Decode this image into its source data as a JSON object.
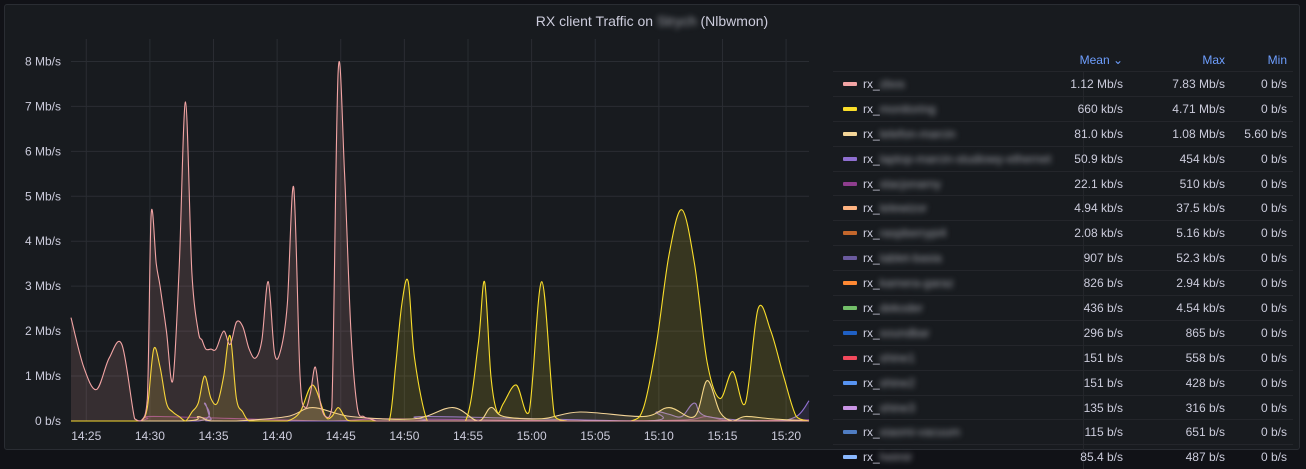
{
  "panel": {
    "title_prefix": "RX client Traffic on",
    "title_host": "Strych",
    "title_suffix": "(Nlbwmon)"
  },
  "legend": {
    "headers": {
      "mean": "Mean ⌄",
      "max": "Max",
      "min": "Min"
    },
    "rows": [
      {
        "prefix": "rx_",
        "name": "zbos",
        "color": "#f2a4a4",
        "mean": "1.12 Mb/s",
        "max": "7.83 Mb/s",
        "min": "0 b/s"
      },
      {
        "prefix": "rx_",
        "name": "monitoring",
        "color": "#fade2a",
        "mean": "660 kb/s",
        "max": "4.71 Mb/s",
        "min": "0 b/s"
      },
      {
        "prefix": "rx_",
        "name": "telefon-marcin",
        "color": "#f4d598",
        "mean": "81.0 kb/s",
        "max": "1.08 Mb/s",
        "min": "5.60 b/s"
      },
      {
        "prefix": "rx_",
        "name": "laptop-marcin-studiowy-ethernet",
        "color": "#8f6fd0",
        "mean": "50.9 kb/s",
        "max": "454 kb/s",
        "min": "0 b/s"
      },
      {
        "prefix": "rx_",
        "name": "stacjonarny",
        "color": "#8e3d8e",
        "mean": "22.1 kb/s",
        "max": "510 kb/s",
        "min": "0 b/s"
      },
      {
        "prefix": "rx_",
        "name": "telewizor",
        "color": "#ffb381",
        "mean": "4.94 kb/s",
        "max": "37.5 kb/s",
        "min": "0 b/s"
      },
      {
        "prefix": "rx_",
        "name": "raspberrypi4",
        "color": "#c4672c",
        "mean": "2.08 kb/s",
        "max": "5.16 kb/s",
        "min": "0 b/s"
      },
      {
        "prefix": "rx_",
        "name": "tablet-basia",
        "color": "#6a5a9e",
        "mean": "907 b/s",
        "max": "52.3 kb/s",
        "min": "0 b/s"
      },
      {
        "prefix": "rx_",
        "name": "kamera-garaz",
        "color": "#ff8833",
        "mean": "826 b/s",
        "max": "2.94 kb/s",
        "min": "0 b/s"
      },
      {
        "prefix": "rx_",
        "name": "dekoder",
        "color": "#73bf69",
        "mean": "436 b/s",
        "max": "4.54 kb/s",
        "min": "0 b/s"
      },
      {
        "prefix": "rx_",
        "name": "soundbar",
        "color": "#1f60c4",
        "mean": "296 b/s",
        "max": "865 b/s",
        "min": "0 b/s"
      },
      {
        "prefix": "rx_",
        "name": "shine1",
        "color": "#f2495c",
        "mean": "151 b/s",
        "max": "558 b/s",
        "min": "0 b/s"
      },
      {
        "prefix": "rx_",
        "name": "shine2",
        "color": "#5794f2",
        "mean": "151 b/s",
        "max": "428 b/s",
        "min": "0 b/s"
      },
      {
        "prefix": "rx_",
        "name": "shine3",
        "color": "#ca95e5",
        "mean": "135 b/s",
        "max": "316 b/s",
        "min": "0 b/s"
      },
      {
        "prefix": "rx_",
        "name": "xiaomi-vacuum",
        "color": "#4f7dc2",
        "mean": "115 b/s",
        "max": "651 b/s",
        "min": "0 b/s"
      },
      {
        "prefix": "rx_",
        "name": "heimir",
        "color": "#8ab8ff",
        "mean": "85.4 b/s",
        "max": "487 b/s",
        "min": "0 b/s"
      }
    ]
  },
  "chart_data": {
    "type": "area",
    "ylim": [
      0,
      8.5
    ],
    "y_ticks": [
      "0 b/s",
      "1 Mb/s",
      "2 Mb/s",
      "3 Mb/s",
      "4 Mb/s",
      "5 Mb/s",
      "6 Mb/s",
      "7 Mb/s",
      "8 Mb/s"
    ],
    "x_ticks": [
      "14:25",
      "14:30",
      "14:35",
      "14:40",
      "14:45",
      "14:50",
      "14:55",
      "15:00",
      "15:05",
      "15:10",
      "15:15",
      "15:20"
    ],
    "x_range_minutes": [
      0,
      58
    ],
    "y_unit": "Mb/s",
    "series": [
      {
        "name": "rx_zbos",
        "color": "#f2a4a4",
        "x": [
          0,
          1,
          2,
          3,
          4,
          5,
          5.5,
          6,
          6.3,
          6.7,
          7,
          7.5,
          8,
          8.5,
          9,
          9.5,
          10,
          10.3,
          10.6,
          11,
          11.4,
          12,
          12.5,
          13,
          13.5,
          14,
          14.5,
          15,
          15.5,
          16,
          16.5,
          17,
          17.5,
          18,
          18.4,
          18.8,
          19.2,
          19.6,
          20,
          20.5,
          21,
          21.5,
          22,
          22.5,
          23,
          23.5,
          24,
          24.5,
          25,
          25.5,
          26,
          26.5,
          27,
          27.5,
          28,
          28.4,
          28.8,
          29,
          29.5,
          30,
          31,
          32,
          34,
          36,
          40,
          44,
          48,
          52,
          56,
          58
        ],
        "y": [
          2.3,
          1.2,
          0.7,
          1.4,
          1.7,
          0.05,
          0,
          0.5,
          4.6,
          3.5,
          3.0,
          2.0,
          0.9,
          3.4,
          7.1,
          3.3,
          2.0,
          1.8,
          1.6,
          1.6,
          1.6,
          2.0,
          1.7,
          2.2,
          2.1,
          1.6,
          1.4,
          1.8,
          3.1,
          1.5,
          1.6,
          2.6,
          5.2,
          1.0,
          0.3,
          0.6,
          1.2,
          0.4,
          0.1,
          0.3,
          7.8,
          5.5,
          2.0,
          0.3,
          0.1,
          0.05,
          0,
          0,
          0,
          0,
          0,
          0,
          0,
          0,
          0,
          0,
          0,
          0,
          0,
          0,
          0,
          0,
          0,
          0,
          0,
          0,
          0,
          0,
          0,
          0
        ]
      },
      {
        "name": "rx_monitoring",
        "color": "#fade2a",
        "x": [
          0,
          4,
          5,
          5.5,
          6,
          6.5,
          7,
          7.5,
          8,
          8.5,
          9,
          9.5,
          10,
          10.5,
          11,
          11.5,
          12,
          12.5,
          13,
          13.5,
          14,
          15,
          16,
          17,
          18,
          19,
          20,
          20.5,
          21,
          21.5,
          22,
          24,
          25,
          25.5,
          26,
          26.5,
          27,
          28,
          29,
          31,
          32,
          32.5,
          33,
          33.5,
          34,
          35,
          36,
          37,
          38,
          39,
          40,
          41,
          42,
          44,
          45,
          46,
          47,
          48,
          49,
          50,
          51,
          52,
          53,
          54,
          55,
          56,
          57,
          58
        ],
        "y": [
          0,
          0,
          0,
          0,
          0.3,
          1.6,
          1.2,
          0.4,
          0.2,
          0.1,
          0,
          0.2,
          0.4,
          1.0,
          0.5,
          0.4,
          1.0,
          1.9,
          0.5,
          0.2,
          0,
          0,
          0,
          0,
          0.2,
          0.8,
          0.1,
          0.1,
          0.3,
          0.1,
          0,
          0,
          0,
          1.2,
          2.6,
          3.1,
          1.4,
          0,
          0,
          0,
          1.7,
          3.1,
          1.0,
          0.2,
          0.4,
          0.8,
          0.2,
          3.1,
          0.1,
          0,
          0,
          0,
          0,
          0,
          0.3,
          1.7,
          3.7,
          4.7,
          3.5,
          1.3,
          0.5,
          1.1,
          0.4,
          2.5,
          2.0,
          1.0,
          0.1,
          0
        ]
      },
      {
        "name": "rx_telefon-marcin",
        "color": "#f4d598",
        "x": [
          0,
          9,
          10,
          11,
          13,
          17,
          19,
          22,
          27,
          30,
          32,
          33,
          34,
          37,
          40,
          45,
          47,
          49,
          50,
          51,
          52,
          53,
          55,
          58
        ],
        "y": [
          0,
          0,
          0.1,
          0,
          0,
          0.1,
          0.3,
          0.1,
          0.05,
          0.3,
          0,
          0.3,
          0.1,
          0.05,
          0.2,
          0.1,
          0.3,
          0.1,
          0.9,
          0.2,
          0,
          0.1,
          0.05,
          0
        ]
      },
      {
        "name": "rx_laptop-marcin-studiowy-ethernet",
        "color": "#8f6fd0",
        "x": [
          0,
          10,
          10.5,
          11,
          12,
          27,
          28,
          45,
          46,
          47,
          48,
          49,
          50,
          55,
          57,
          58
        ],
        "y": [
          0,
          0,
          0.4,
          0.05,
          0,
          0,
          0.1,
          0,
          0.2,
          0.15,
          0.1,
          0.4,
          0.1,
          0,
          0.1,
          0.45
        ]
      },
      {
        "name": "rx_stacjonarny",
        "color": "#8e3d8e",
        "x": [
          0,
          5,
          6,
          7,
          20,
          25,
          40,
          48,
          50,
          52,
          58
        ],
        "y": [
          0,
          0,
          0.05,
          0.1,
          0,
          0.05,
          0,
          0.02,
          0.1,
          0,
          0.03
        ]
      }
    ]
  }
}
